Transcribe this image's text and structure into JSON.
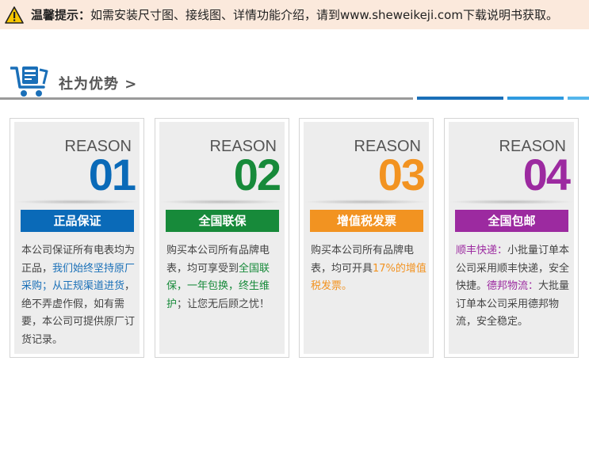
{
  "notice": {
    "title": "温馨提示：",
    "text": "如需安装尺寸图、接线图、详情功能介绍，请到www.sheweikeji.com下载说明书获取。",
    "icon": "warning-icon"
  },
  "section": {
    "title": "社为优势 >",
    "icon": "shopping-cart-icon"
  },
  "colors": {
    "blue": "#0a6ab8",
    "green": "#178a3a",
    "orange": "#f29321",
    "purple": "#9c2aa0",
    "link_blue": "#1a70b8"
  },
  "cards": [
    {
      "reason": "REASON",
      "number": "01",
      "banner": "正品保证",
      "desc": [
        {
          "t": "本公司保证所有电表均为正品，",
          "c": ""
        },
        {
          "t": "我们始终坚持原厂采购；从正规渠道进货",
          "c": "#1a70b8"
        },
        {
          "t": "，绝不弄虚作假，如有需要，本公司可提供原厂订货记录。",
          "c": ""
        }
      ]
    },
    {
      "reason": "REASON",
      "number": "02",
      "banner": "全国联保",
      "desc": [
        {
          "t": "购买本公司所有品牌电表，均可享受到",
          "c": ""
        },
        {
          "t": "全国联保，一年包换，终生维护",
          "c": "#178a3a"
        },
        {
          "t": "；让您无后顾之忧！",
          "c": ""
        }
      ]
    },
    {
      "reason": "REASON",
      "number": "03",
      "banner": "增值税发票",
      "desc": [
        {
          "t": "购买本公司所有品牌电表，均可开具",
          "c": ""
        },
        {
          "t": "17%的增值税发票。",
          "c": "#f29321"
        }
      ]
    },
    {
      "reason": "REASON",
      "number": "04",
      "banner": "全国包邮",
      "desc": [
        {
          "t": "顺丰快递：",
          "c": "#9c2aa0"
        },
        {
          "t": "小批量订单本公司采用顺丰快递，安全快捷。",
          "c": ""
        },
        {
          "t": "德邦物流：",
          "c": "#9c2aa0"
        },
        {
          "t": "大批量订单本公司采用德邦物流，安全稳定。",
          "c": ""
        }
      ]
    }
  ]
}
